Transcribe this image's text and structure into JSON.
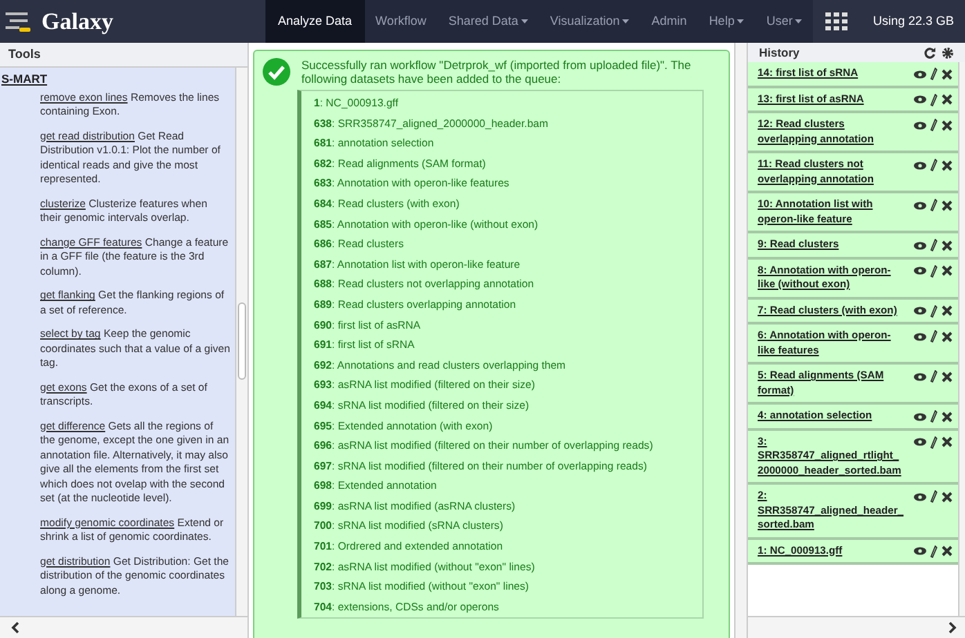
{
  "brand": "Galaxy",
  "nav": [
    {
      "label": "Analyze Data",
      "selected": true,
      "dropdown": false
    },
    {
      "label": "Workflow",
      "selected": false,
      "dropdown": false
    },
    {
      "label": "Shared Data",
      "selected": false,
      "dropdown": true
    },
    {
      "label": "Visualization",
      "selected": false,
      "dropdown": true
    },
    {
      "label": "Admin",
      "selected": false,
      "dropdown": false
    },
    {
      "label": "Help",
      "selected": false,
      "dropdown": true
    },
    {
      "label": "User",
      "selected": false,
      "dropdown": true
    }
  ],
  "usage": "Using 22.3 GB",
  "tools": {
    "title": "Tools",
    "section": "S-MART",
    "items": [
      {
        "link": "remove exon lines",
        "description": "Removes the lines containing Exon."
      },
      {
        "link": "get read distribution",
        "description": "Get Read Distribution v1.0.1: Plot the number of identical reads and give the most represented."
      },
      {
        "link": "clusterize",
        "description": "Clusterize features when their genomic intervals overlap."
      },
      {
        "link": "change GFF features",
        "description": "Change a feature in a GFF file (the feature is the 3rd column)."
      },
      {
        "link": "get flanking",
        "description": "Get the flanking regions of a set of reference."
      },
      {
        "link": "select by tag",
        "description": "Keep the genomic coordinates such that a value of a given tag."
      },
      {
        "link": "get exons",
        "description": "Get the exons of a set of transcripts."
      },
      {
        "link": "get difference",
        "description": "Gets all the regions of the genome, except the one given in an annotation file. Alternatively, it may also give all the elements from the first set which does not ovelap with the second set (at the nucleotide level)."
      },
      {
        "link": "modify genomic coordinates",
        "description": "Extend or shrink a list of genomic coordinates."
      },
      {
        "link": "get distribution",
        "description": "Get Distribution: Get the distribution of the genomic coordinates along a genome."
      }
    ]
  },
  "message": {
    "text": "Successfully ran workflow \"Detrprok_wf (imported from uploaded file)\". The following datasets have been added to the queue:",
    "datasets": [
      {
        "text": "**1**: NC_000913.gff"
      },
      {
        "text": "**638**: SRR358747_aligned_2000000_header.bam"
      },
      {
        "text": "**681**: annotation selection"
      },
      {
        "text": "**682**: Read alignments (SAM format)"
      },
      {
        "text": "**683**: Annotation with operon-like features"
      },
      {
        "text": "**684**: Read clusters (with exon)"
      },
      {
        "text": "**685**: Annotation with operon-like (without exon)"
      },
      {
        "text": "**686**: Read clusters"
      },
      {
        "text": "**687**: Annotation list with operon-like feature"
      },
      {
        "text": "**688**: Read clusters not overlapping annotation"
      },
      {
        "text": "**689**: Read clusters overlapping annotation"
      },
      {
        "text": "**690**: first list of asRNA"
      },
      {
        "text": "**691**: first list of sRNA"
      },
      {
        "text": "**692**: Annotations and read clusters overlapping them"
      },
      {
        "text": "**693**: asRNA list modified (filtered on their size)"
      },
      {
        "text": "**694**: sRNA list modified (filtered on their size)"
      },
      {
        "text": "**695**: Extended annotation (with exon)"
      },
      {
        "text": "**696**: asRNA list modified (filtered on their number of overlapping reads)"
      },
      {
        "text": "**697**: sRNA list modified (filtered on their number of overlapping reads)"
      },
      {
        "text": "**698**: Extended annotation"
      },
      {
        "text": "**699**: asRNA list modified (asRNA clusters)"
      },
      {
        "text": "**700**: sRNA list modified (sRNA clusters)"
      },
      {
        "text": "**701**: Ordrered and extended annotation"
      },
      {
        "text": "**702**: asRNA list modified (without \"exon\" lines)"
      },
      {
        "text": "**703**: sRNA list modified (without \"exon\" lines)"
      },
      {
        "text": "**704**: extensions, CDSs and/or operons"
      }
    ]
  },
  "history": {
    "title": "History",
    "items": [
      {
        "title": "14: first list of sRNA"
      },
      {
        "title": "13: first list of asRNA"
      },
      {
        "title": "12: Read clusters overlapping annotation"
      },
      {
        "title": "11: Read clusters not overlapping annotation"
      },
      {
        "title": "10: Annotation list with operon-like feature"
      },
      {
        "title": "9: Read clusters"
      },
      {
        "title": "8: Annotation with operon-like (without exon)"
      },
      {
        "title": "7: Read clusters (with exon)"
      },
      {
        "title": "6: Annotation with operon-like features"
      },
      {
        "title": "5: Read alignments (SAM format)"
      },
      {
        "title": "4: annotation selection"
      },
      {
        "title": "3: SRR358747_aligned_rtlight_2000000_header_sorted.bam"
      },
      {
        "title": "2: SRR358747_aligned_header_sorted.bam"
      },
      {
        "title": "1: NC_000913.gff"
      }
    ]
  }
}
